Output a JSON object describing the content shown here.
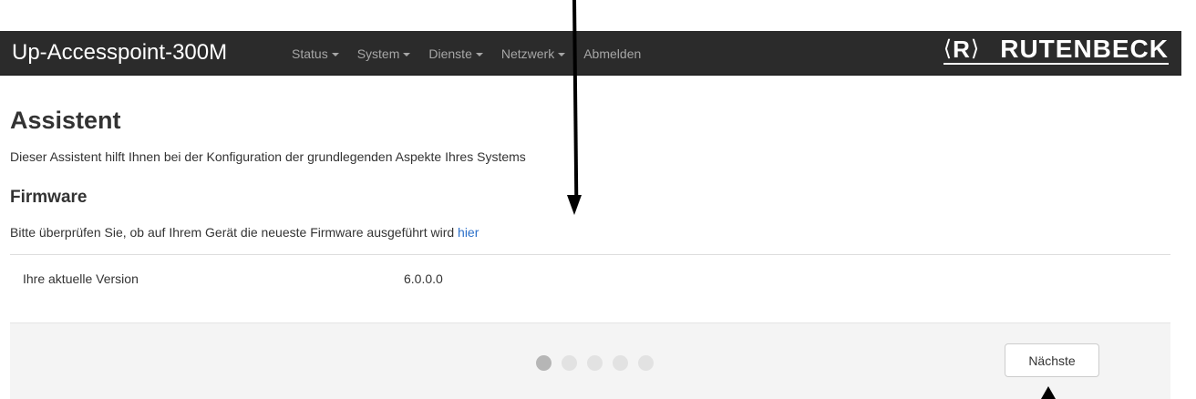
{
  "navbar": {
    "brand": "Up-Accesspoint-300M",
    "menu": [
      {
        "label": "Status",
        "dropdown": true
      },
      {
        "label": "System",
        "dropdown": true
      },
      {
        "label": "Dienste",
        "dropdown": true
      },
      {
        "label": "Netzwerk",
        "dropdown": true
      },
      {
        "label": "Abmelden",
        "dropdown": false
      }
    ],
    "logo": {
      "mark": "R",
      "text": "RUTENBECK"
    }
  },
  "page": {
    "title": "Assistent",
    "subtitle": "Dieser Assistent hilft Ihnen bei der Konfiguration der grundlegenden Aspekte Ihres Systems"
  },
  "firmware": {
    "heading": "Firmware",
    "hint_text": "Bitte überprüfen Sie, ob auf Ihrem Gerät die neueste Firmware ausgeführt wird ",
    "hint_link": "hier",
    "version_label": "Ihre aktuelle Version",
    "version_value": "6.0.0.0"
  },
  "wizard": {
    "total_steps": 5,
    "current_step": 1,
    "next_label": "Nächste"
  },
  "colors": {
    "navbar_bg": "#2b2b2b",
    "link": "#2a6fc9",
    "footer_bg": "#f4f4f4"
  }
}
